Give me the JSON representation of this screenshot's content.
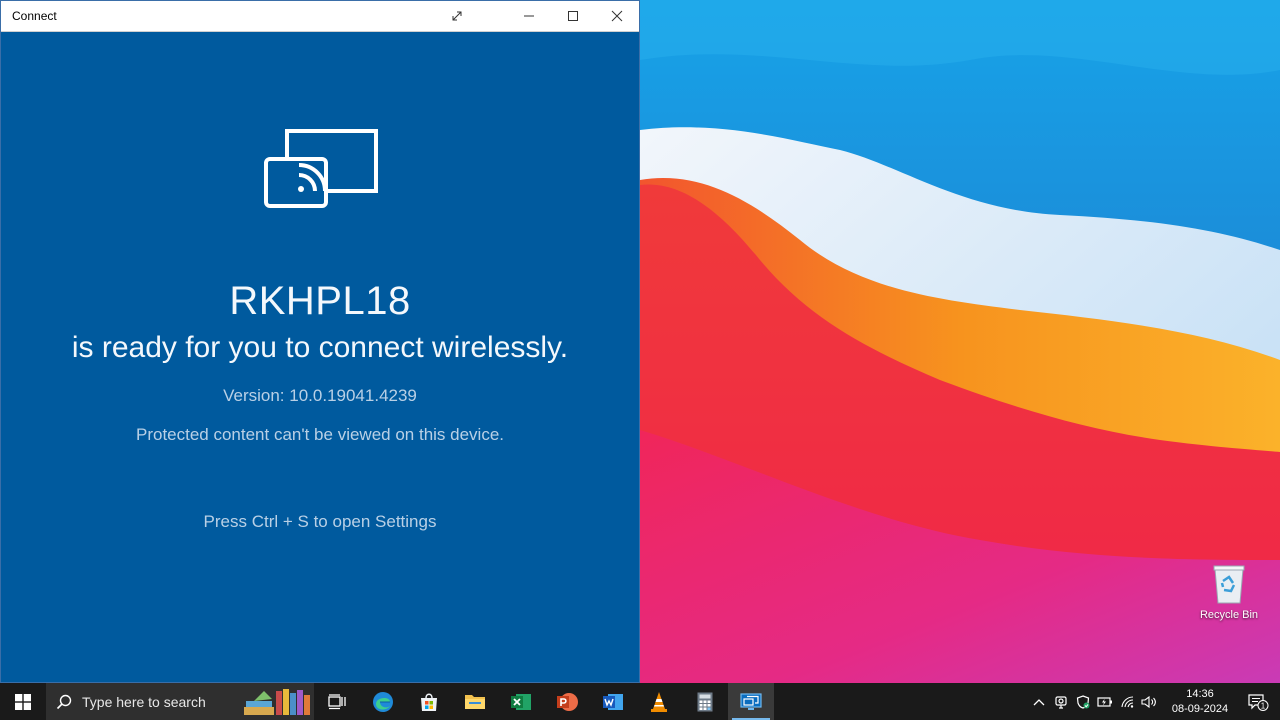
{
  "window": {
    "title": "Connect",
    "device_name": "RKHPL18",
    "ready_text": "is ready for you to connect wirelessly.",
    "version_text": "Version: 10.0.19041.4239",
    "protected_text": "Protected content can't be viewed on this device.",
    "hint_text": "Press Ctrl + S to open Settings",
    "controls": [
      "expand",
      "minimize",
      "maximize",
      "close"
    ],
    "background_color": "#005a9e"
  },
  "desktop": {
    "recycle_bin_label": "Recycle Bin"
  },
  "taskbar": {
    "search_placeholder": "Type here to search",
    "pinned_apps": [
      "task-view",
      "edge",
      "store",
      "file-explorer",
      "excel",
      "powerpoint",
      "word",
      "vlc",
      "calculator",
      "connect"
    ],
    "active_app": "connect",
    "clock": {
      "time": "14:36",
      "date": "08-09-2024"
    },
    "notification_count": "1",
    "accent_color": "#76b9ed"
  }
}
